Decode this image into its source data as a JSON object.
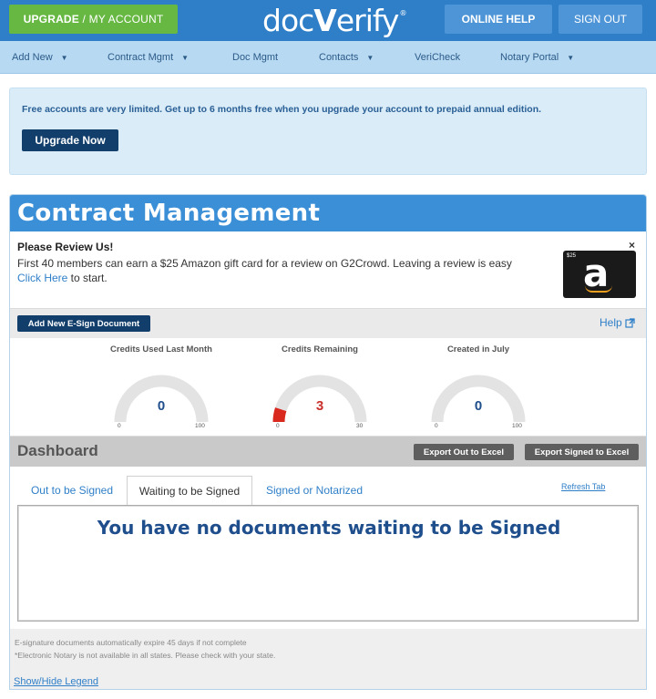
{
  "topbar": {
    "upgrade_label": "UPGRADE",
    "upgrade_sep": " / ",
    "account_label": "MY ACCOUNT",
    "logo_prefix": "doc",
    "logo_v": "V",
    "logo_suffix": "erify",
    "logo_mark": "®",
    "online_help_label": "ONLINE HELP",
    "sign_out_label": "SIGN OUT",
    "brand_color": "#2f7fc8",
    "upgrade_color": "#67b843"
  },
  "nav": {
    "items": [
      {
        "label": "Add New",
        "has_caret": true
      },
      {
        "label": "Contract Mgmt",
        "has_caret": true
      },
      {
        "label": "Doc Mgmt",
        "has_caret": false
      },
      {
        "label": "Contacts",
        "has_caret": true
      },
      {
        "label": "VeriCheck",
        "has_caret": false
      },
      {
        "label": "Notary Portal",
        "has_caret": true
      }
    ],
    "caret": "▼"
  },
  "notice": {
    "text": "Free accounts are very limited. Get up to 6 months free when you upgrade your account to prepaid annual edition.",
    "button_label": "Upgrade Now"
  },
  "contract": {
    "title": "Contract Management",
    "review": {
      "title": "Please Review Us!",
      "body": "First 40 members can earn a $25 Amazon gift card for a review on G2Crowd. Leaving a review is easy",
      "link": "Click Here",
      "after_link": " to start.",
      "close": "×",
      "gift_amount": "$25",
      "gift_letter": "a"
    },
    "add_button_label": "Add New E-Sign Document",
    "help_label": "Help",
    "gauges": [
      {
        "title": "Credits Used Last Month",
        "value": "0",
        "min": "0",
        "max": "100",
        "fraction": 0
      },
      {
        "title": "Credits Remaining",
        "value": "3",
        "min": "0",
        "max": "30",
        "fraction": 0.1
      },
      {
        "title": "Created in July",
        "value": "0",
        "min": "0",
        "max": "100",
        "fraction": 0
      }
    ],
    "dashboard_title": "Dashboard",
    "export_out_label": "Export Out to Excel",
    "export_signed_label": "Export Signed to Excel",
    "tabs": [
      {
        "label": "Out to be Signed",
        "active": false
      },
      {
        "label": "Waiting to be Signed",
        "active": true
      },
      {
        "label": "Signed or Notarized",
        "active": false
      }
    ],
    "refresh_label": "Refresh Tab",
    "empty_message": "You have no documents waiting to be Signed",
    "notes": [
      "E-signature documents automatically expire 45 days if not complete",
      "*Electronic Notary is not available in all states. Please check with your state."
    ],
    "legend_link": "Show/Hide Legend"
  }
}
